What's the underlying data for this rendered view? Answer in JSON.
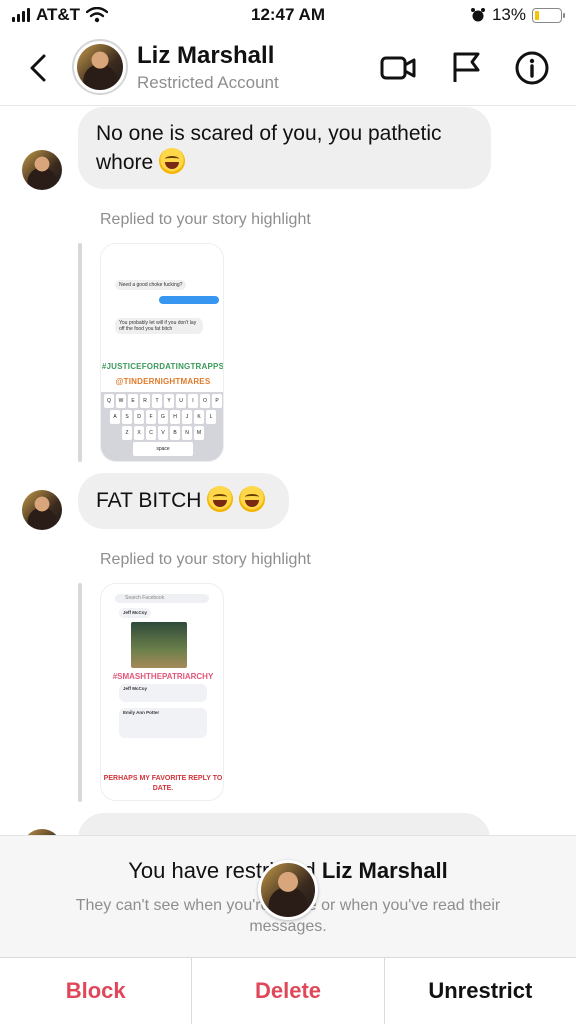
{
  "status_bar": {
    "carrier": "AT&T",
    "time": "12:47 AM",
    "battery": "13%"
  },
  "header": {
    "name": "Liz Marshall",
    "subtitle": "Restricted Account"
  },
  "messages": [
    {
      "type": "text",
      "text": "No one is scared of you, you pathetic whore",
      "emoji": "tears-of-joy"
    },
    {
      "type": "story_reply",
      "label": "Replied to your story highlight"
    },
    {
      "type": "text",
      "text": "FAT BITCH",
      "emoji": "tears-of-joy rolling-laughing"
    },
    {
      "type": "story_reply",
      "label": "Replied to your story highlight"
    }
  ],
  "story1": {
    "msg1": "Need a good choke fucking?",
    "msg2": "You probably let will if you don't lay off the food you fat bitch",
    "tag1": "#JUSTICEFORDATINGTRAPPS",
    "tag2": "@TINDERNIGHTMARES",
    "space_key": "space"
  },
  "story2": {
    "search": "Search Facebook",
    "name1": "Jeff McCoy",
    "name2": "Emily Ann Potter",
    "tag": "#SMASHTHEPATRIARCHY",
    "footer": "PERHAPS MY FAVORITE REPLY TO DATE."
  },
  "restrict_panel": {
    "title_prefix": "You have restricted ",
    "title_name": "Liz Marshall",
    "description": "They can't see when you're online or when you've read their messages."
  },
  "actions": {
    "block": "Block",
    "delete": "Delete",
    "unrestrict": "Unrestrict"
  },
  "colors": {
    "danger": "#e0485a",
    "bubble": "#efefef",
    "secondary_text": "#8e8e8e"
  }
}
